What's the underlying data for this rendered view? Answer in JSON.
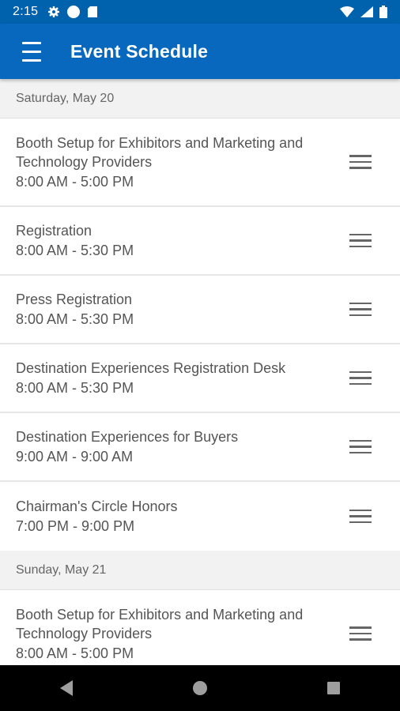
{
  "status_bar": {
    "time": "2:15",
    "icons": [
      "gear-icon",
      "circle-icon",
      "sd-card-icon",
      "wifi-icon",
      "signal-icon",
      "battery-icon"
    ]
  },
  "app_bar": {
    "title": "Event Schedule",
    "menu_icon": "hamburger-menu-icon"
  },
  "schedule": [
    {
      "day": "Saturday, May 20",
      "events": [
        {
          "title": "Booth Setup for Exhibitors and Marketing and Technology Providers",
          "time": "8:00 AM - 5:00 PM"
        },
        {
          "title": "Registration",
          "time": "8:00 AM - 5:30 PM"
        },
        {
          "title": "Press Registration",
          "time": "8:00 AM - 5:30 PM"
        },
        {
          "title": "Destination Experiences Registration Desk",
          "time": "8:00 AM - 5:30 PM"
        },
        {
          "title": "Destination Experiences for Buyers",
          "time": "9:00 AM - 9:00 AM"
        },
        {
          "title": "Chairman's Circle Honors",
          "time": "7:00 PM - 9:00 PM"
        }
      ]
    },
    {
      "day": "Sunday, May 21",
      "events": [
        {
          "title": "Booth Setup for Exhibitors and Marketing and Technology Providers",
          "time": "8:00 AM - 5:00 PM"
        }
      ]
    }
  ],
  "nav_bar": {
    "icons": [
      "back-icon",
      "home-icon",
      "recents-icon"
    ]
  },
  "colors": {
    "status_bar": "#0062ad",
    "app_bar": "#0868bd",
    "day_header_bg": "#f2f2f2",
    "text": "#555555"
  }
}
